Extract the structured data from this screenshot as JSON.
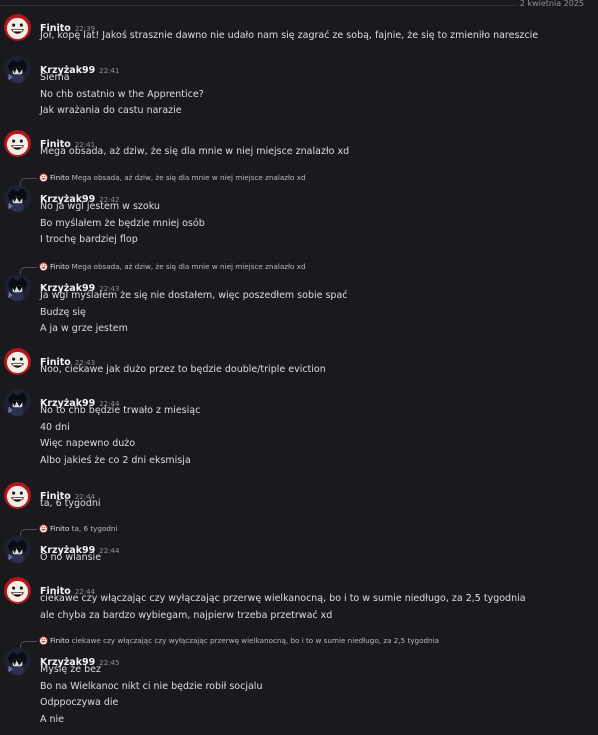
{
  "date_divider": "2 kwietnia 2025",
  "users": {
    "finito": {
      "name": "Finito",
      "avatar_icon": "smiley-face-icon"
    },
    "krzyzak": {
      "name": "Krzyżak99",
      "avatar_icon": "dark-anime-avatar-icon"
    }
  },
  "colors": {
    "background": "#1a1a1e",
    "author": "#f2f3f5",
    "text": "#dbdee1",
    "muted": "#8f9299"
  },
  "messages": [
    {
      "author": "Finito",
      "time": "22:39",
      "lines": [
        "Joł, kopę lat! Jakoś strasznie dawno nie udało nam się zagrać ze sobą, fajnie, że się to zmieniło nareszcie"
      ]
    },
    {
      "author": "Krzyżak99",
      "time": "22:41",
      "lines": [
        "Siema",
        "No chb ostatnio w the Apprentice?",
        "Jak wrażania do castu narazie"
      ]
    },
    {
      "author": "Finito",
      "time": "22:41",
      "lines": [
        "Mega obsada, aż dziw, że się dla mnie w niej miejsce znalazło xd"
      ]
    },
    {
      "author": "Krzyżak99",
      "time": "22:42",
      "reply": {
        "author": "Finito",
        "text": "Mega obsada, aż dziw, że się dla mnie w niej miejsce znalazło xd"
      },
      "lines": [
        "No ja wgl jestem w szoku",
        "Bo myślałem że będzie mniej osób",
        "I trochę bardziej flop"
      ]
    },
    {
      "author": "Krzyżak99",
      "time": "22:43",
      "reply": {
        "author": "Finito",
        "text": "Mega obsada, aż dziw, że się dla mnie w niej miejsce znalazło xd"
      },
      "lines": [
        "Ja wgl myślałem że się nie dostałem, więc poszedłem sobie spać",
        "Budzę się",
        "A ja w grze jestem"
      ]
    },
    {
      "author": "Finito",
      "time": "22:43",
      "lines": [
        "Noo, ciekawe jak dużo przez to będzie double/triple eviction"
      ]
    },
    {
      "author": "Krzyżak99",
      "time": "22:44",
      "lines": [
        "No to chb będzie trwało z miesiąc",
        "40 dni",
        "Więc napewno dużo",
        "Albo jakieś że co 2 dni eksmisja"
      ]
    },
    {
      "author": "Finito",
      "time": "22:44",
      "lines": [
        "ta, 6 tygodni"
      ]
    },
    {
      "author": "Krzyżak99",
      "time": "22:44",
      "reply": {
        "author": "Finito",
        "text": "ta, 6 tygodni"
      },
      "lines": [
        "O no wlansie"
      ]
    },
    {
      "author": "Finito",
      "time": "22:44",
      "lines": [
        "ciekawe czy włączając czy wyłączając przerwę wielkanocną, bo i to w sumie niedługo, za 2,5 tygodnia",
        "ale chyba za bardzo wybiegam, najpierw trzeba przetrwać xd"
      ]
    },
    {
      "author": "Krzyżak99",
      "time": "22:45",
      "reply": {
        "author": "Finito",
        "text": "ciekawe czy włączając czy wyłączając przerwę wielkanocną, bo i to w sumie niedługo, za 2,5 tygodnia"
      },
      "lines": [
        "Myślę że bez",
        "Bo na Wielkanoc nikt ci nie będzie robił socjalu",
        "Odppoczywa die",
        "A nie"
      ]
    }
  ]
}
